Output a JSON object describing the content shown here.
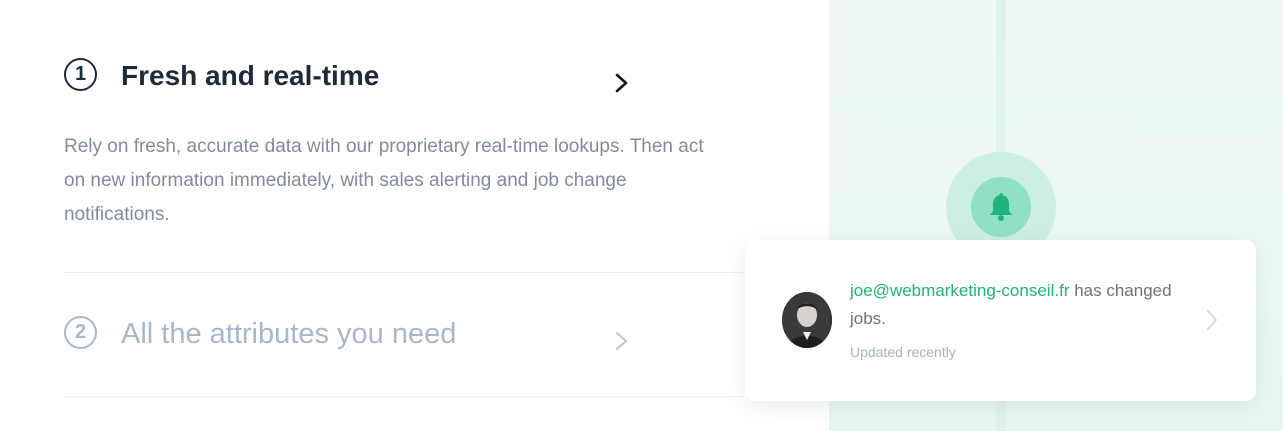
{
  "features": [
    {
      "number": "1",
      "title": "Fresh and real-time",
      "description": "Rely on fresh, accurate data with our proprietary real-time lookups. Then act on new information immediately, with sales alerting and job change notifications."
    },
    {
      "number": "2",
      "title": "All the attributes you need"
    }
  ],
  "notification": {
    "email": "joe@webmarketing-conseil.fr",
    "message": " has changed jobs.",
    "status": "Updated recently"
  },
  "colors": {
    "accent": "#1fb572",
    "dark_text": "#1e2a3b",
    "muted_text": "#a8b8c6",
    "panel_bg": "#eef8f5",
    "bell": "#8fe0c7"
  },
  "icons": [
    "chevron-right-icon",
    "bell-icon",
    "avatar"
  ]
}
